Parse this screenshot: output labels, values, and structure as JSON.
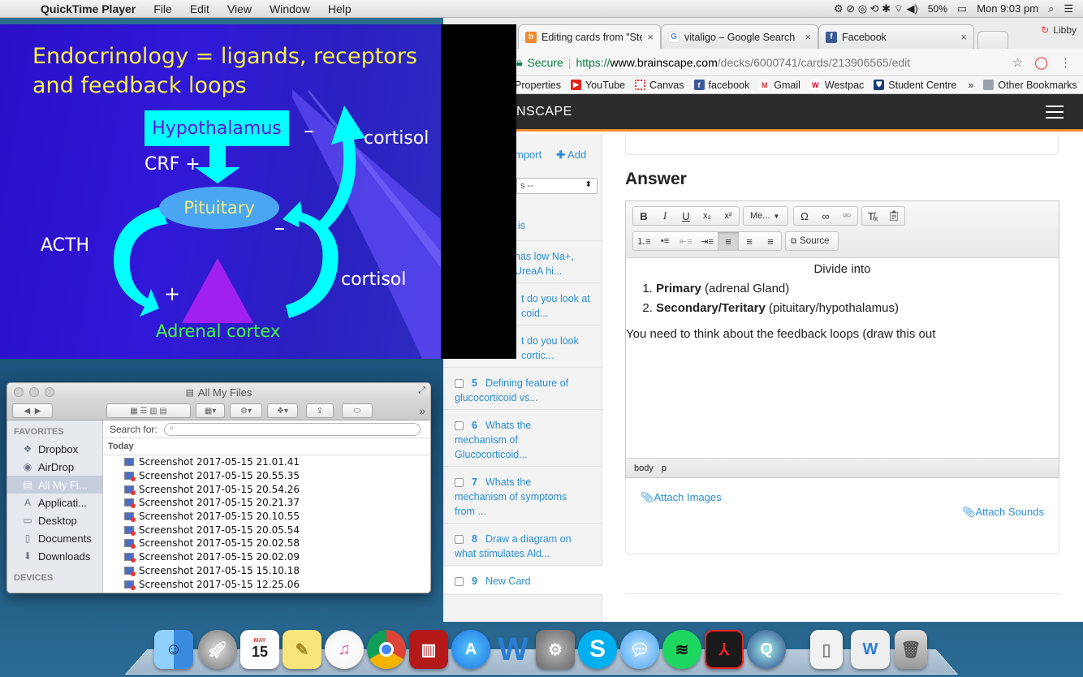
{
  "menubar": {
    "app_name": "QuickTime Player",
    "menus": [
      "File",
      "Edit",
      "View",
      "Window",
      "Help"
    ],
    "battery": "50%",
    "clock": "Mon 9:03 pm"
  },
  "browser": {
    "tabs": [
      {
        "title": "Editing cards from \"Steroid",
        "favicon": "brainscape-icon"
      },
      {
        "title": "vitaligo – Google Search",
        "favicon": "google-icon"
      },
      {
        "title": "Facebook",
        "favicon": "facebook-icon"
      }
    ],
    "profile": "Libby",
    "secure_label": "Secure",
    "url_scheme": "https://",
    "url_host": "www.brainscape.com",
    "url_path": "/decks/6000741/cards/213906565/edit",
    "bookmarks": [
      "Properties",
      "YouTube",
      "Canvas",
      "facebook",
      "Gmail",
      "Westpac",
      "Student Centre"
    ],
    "bookmarks_more": "»",
    "other_bookmarks": "Other Bookmarks"
  },
  "brainscape": {
    "logo_visible": "NSCAPE",
    "sidebar": {
      "import_label": "mport",
      "add_label": "Add",
      "select_value": "s --",
      "cards": [
        {
          "num": "",
          "line1": "is",
          "line2": "",
          "line3": ""
        },
        {
          "num": "",
          "line1": "has low Na+,",
          "line2": "UreaA hi...",
          "line3": ""
        },
        {
          "num": "",
          "line1": "t do you look at",
          "line2": "coid...",
          "line3": ""
        },
        {
          "num": "",
          "line1": "t do you look",
          "line2": "cortic...",
          "line3": ""
        },
        {
          "num": "5",
          "line1": "Defining feature of",
          "line2": "glucocorticoid vs...",
          "line3": ""
        },
        {
          "num": "6",
          "line1": "Whats the",
          "line2": "mechanism of",
          "line3": "Glucocorticoid..."
        },
        {
          "num": "7",
          "line1": "Whats the",
          "line2": "mechanism of symptoms",
          "line3": "from ..."
        },
        {
          "num": "8",
          "line1": "Draw a diagram on",
          "line2": "what stimulates Ald...",
          "line3": ""
        },
        {
          "num": "9",
          "line1": "New Card",
          "line2": "",
          "line3": ""
        }
      ]
    },
    "answer_heading": "Answer",
    "toolbar": {
      "bold": "B",
      "italic": "I",
      "underline": "U",
      "subscript": "x₂",
      "superscript": "x²",
      "format_menu": "Me...",
      "source": "Source"
    },
    "editor": {
      "line1": "Divide into",
      "item1_bold": "Primary",
      "item1_rest": " (adrenal Gland)",
      "item2_bold": "Secondary/Teritary",
      "item2_rest": " (pituitary/hypothalamus)",
      "paragraph": "You need to think about the feedback loops (draw this out"
    },
    "pathbar": [
      "body",
      "p"
    ],
    "attach_images": "Attach Images",
    "attach_sounds": "Attach Sounds"
  },
  "slide": {
    "title_line1": "Endocrinology = ligands, receptors",
    "title_line2": "and feedback loops",
    "hypothalamus": "Hypothalamus",
    "crf": "CRF +",
    "pituitary": "Pituitary",
    "acth": "ACTH",
    "cortisol_top": "cortisol",
    "cortisol_bottom": "cortisol",
    "minus1": "–",
    "minus2": "–",
    "plus": "+",
    "adrenal": "Adrenal cortex"
  },
  "finder": {
    "title": "All My Files",
    "favorites_head": "FAVORITES",
    "favorites": [
      {
        "label": "Dropbox",
        "icon": "dropbox-icon"
      },
      {
        "label": "AirDrop",
        "icon": "airdrop-icon"
      },
      {
        "label": "All My Fi...",
        "icon": "all-files-icon"
      },
      {
        "label": "Applicati...",
        "icon": "applications-icon"
      },
      {
        "label": "Desktop",
        "icon": "desktop-icon"
      },
      {
        "label": "Documents",
        "icon": "documents-icon"
      },
      {
        "label": "Downloads",
        "icon": "downloads-icon"
      }
    ],
    "devices_head": "DEVICES",
    "search_for": "Search for:",
    "today": "Today",
    "files": [
      "Screenshot 2017-05-15 21.01.41",
      "Screenshot 2017-05-15 20.55.35",
      "Screenshot 2017-05-15 20.54.26",
      "Screenshot 2017-05-15 20.21.37",
      "Screenshot 2017-05-15 20.10.55",
      "Screenshot 2017-05-15 20.05.54",
      "Screenshot 2017-05-15 20.02.58",
      "Screenshot 2017-05-15 20.02.09",
      "Screenshot 2017-05-15 15.10.18",
      "Screenshot 2017-05-15 12.25.06"
    ]
  },
  "dock": {
    "calendar_month": "MAY",
    "calendar_day": "15",
    "apps": [
      "finder-icon",
      "launchpad-icon",
      "calendar-icon",
      "notes-icon",
      "itunes-icon",
      "chrome-icon",
      "photobooth-icon",
      "appstore-icon",
      "word-icon",
      "system-preferences-icon",
      "skype-icon",
      "messages-icon",
      "spotify-icon",
      "acrobat-icon",
      "quicktime-icon",
      "document-icon",
      "word-document-icon",
      "trash-icon"
    ]
  }
}
